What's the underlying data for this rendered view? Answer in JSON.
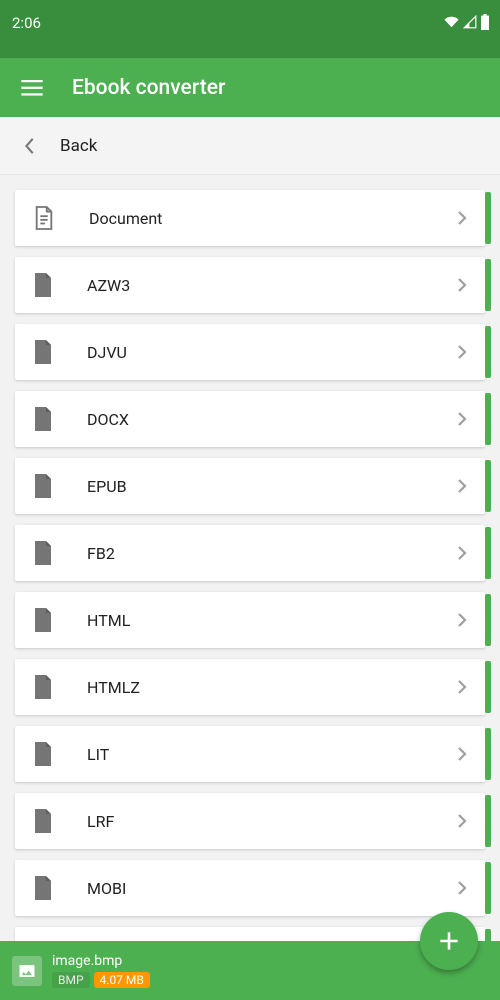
{
  "status": {
    "time": "2:06"
  },
  "appbar": {
    "title": "Ebook converter"
  },
  "back": {
    "label": "Back"
  },
  "list": {
    "items": [
      {
        "label": "Document",
        "icon": "document"
      },
      {
        "label": "AZW3",
        "icon": "file"
      },
      {
        "label": "DJVU",
        "icon": "file"
      },
      {
        "label": "DOCX",
        "icon": "file"
      },
      {
        "label": "EPUB",
        "icon": "file"
      },
      {
        "label": "FB2",
        "icon": "file"
      },
      {
        "label": "HTML",
        "icon": "file"
      },
      {
        "label": "HTMLZ",
        "icon": "file"
      },
      {
        "label": "LIT",
        "icon": "file"
      },
      {
        "label": "LRF",
        "icon": "file"
      },
      {
        "label": "MOBI",
        "icon": "file"
      }
    ]
  },
  "snackbar": {
    "filename": "image.bmp",
    "type_badge": "BMP",
    "size_badge": "4.07 MB"
  },
  "colors": {
    "primary": "#4caf50",
    "primary_dark": "#388e3c",
    "accent": "#ff9800",
    "text": "#212121",
    "icon_grey": "#757575",
    "chevron_grey": "#9f9f9f",
    "background": "#f2f2f2",
    "card_bg": "#ffffff",
    "white": "#ffffff"
  }
}
